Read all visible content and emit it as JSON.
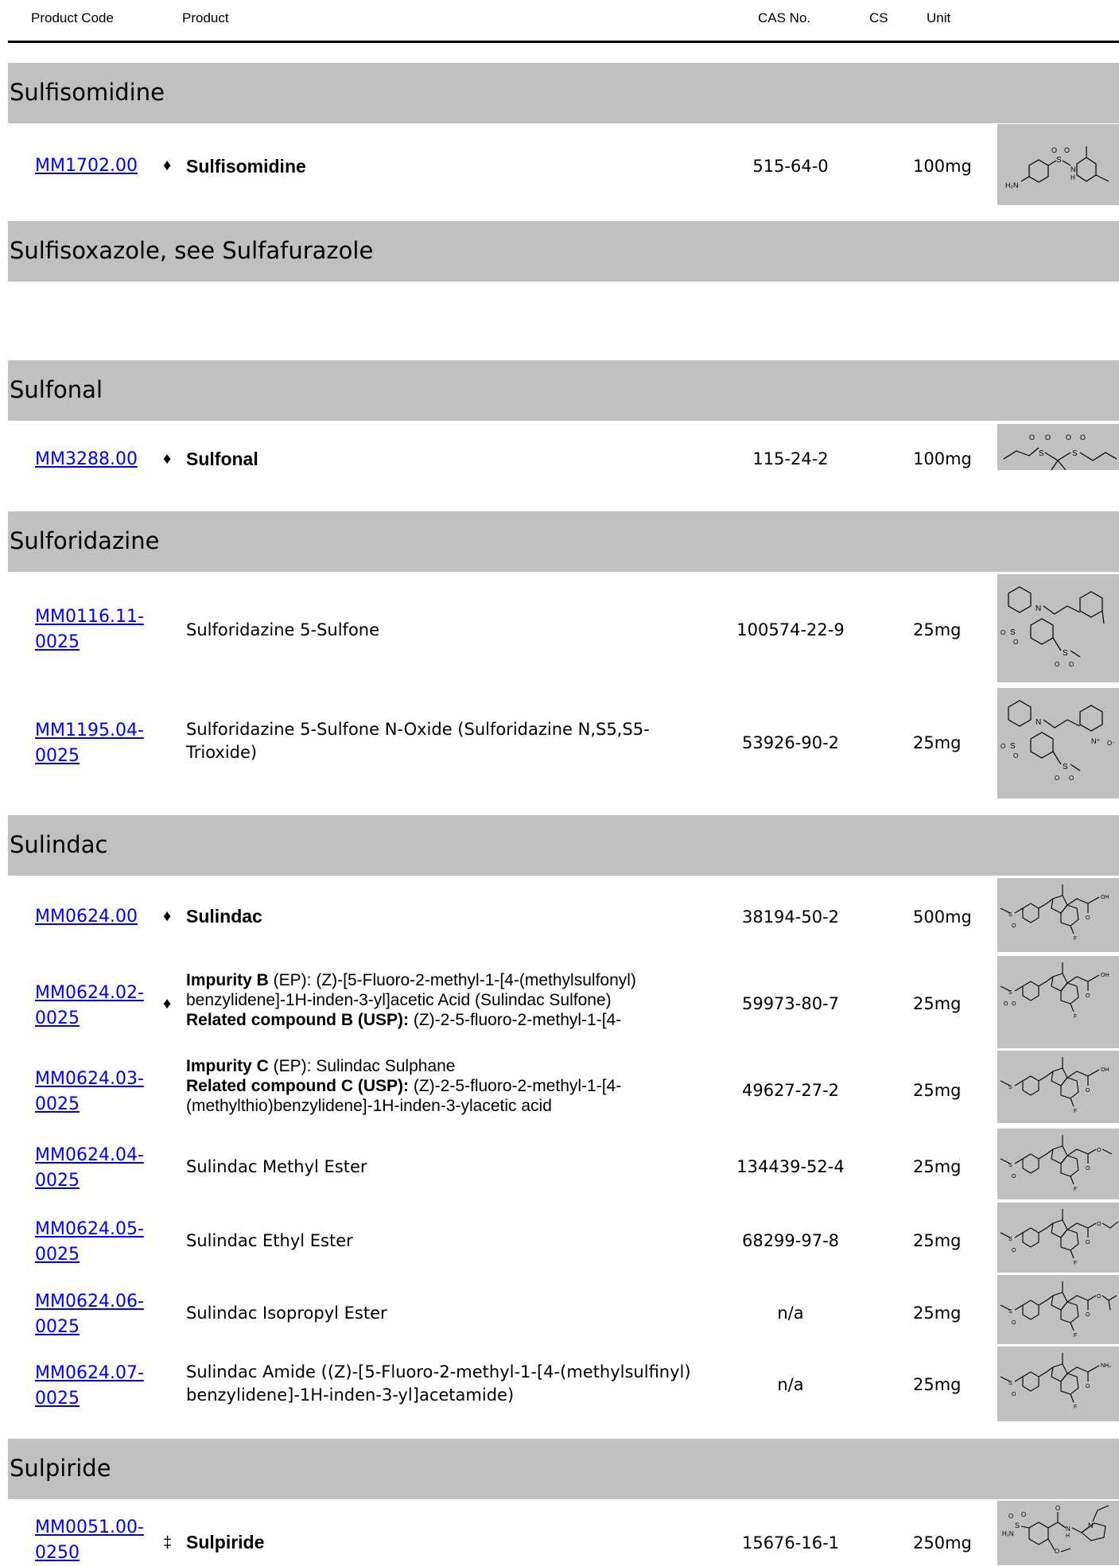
{
  "header": {
    "product_code": "Product Code",
    "product": "Product",
    "cas": "CAS No.",
    "cs": "CS",
    "unit": "Unit"
  },
  "sections": [
    {
      "title": "Sulfisomidine",
      "items": [
        {
          "code_lines": [
            "MM1702.00"
          ],
          "marker": "♦",
          "name": "Sulfisomidine",
          "bold": true,
          "cas": "515-64-0",
          "unit": "100mg",
          "structure_icon": "sulfisomidine-structure"
        }
      ]
    },
    {
      "title": "Sulfisoxazole, see Sulfafurazole",
      "items": []
    },
    {
      "title": "Sulfonal",
      "items": [
        {
          "code_lines": [
            "MM3288.00"
          ],
          "marker": "♦",
          "name": "Sulfonal",
          "bold": true,
          "cas": "115-24-2",
          "unit": "100mg",
          "structure_icon": "sulfonal-structure"
        }
      ]
    },
    {
      "title": "Sulforidazine",
      "items": [
        {
          "code_lines": [
            "MM0116.11-",
            "0025"
          ],
          "marker": "",
          "name": "Sulforidazine 5-Sulfone",
          "bold": false,
          "cas": "100574-22-9",
          "unit": "25mg",
          "structure_icon": "sulforidazine-sulfone-structure"
        },
        {
          "code_lines": [
            "MM1195.04-",
            "0025"
          ],
          "marker": "",
          "name_lines": [
            "Sulforidazine 5-Sulfone N-Oxide (Sulforidazine N,S5,S5-",
            "Trioxide)"
          ],
          "bold": false,
          "cas": "53926-90-2",
          "unit": "25mg",
          "structure_icon": "sulforidazine-trioxide-structure"
        }
      ]
    },
    {
      "title": "Sulindac",
      "items": [
        {
          "code_lines": [
            "MM0624.00"
          ],
          "marker": "♦",
          "name": "Sulindac",
          "bold": true,
          "cas": "38194-50-2",
          "unit": "500mg",
          "structure_icon": "sulindac-structure"
        },
        {
          "code_lines": [
            "MM0624.02-",
            "0025"
          ],
          "marker": "♦",
          "rich_lines": [
            {
              "b": "Impurity B",
              "t": " (EP): (Z)-[5-Fluoro-2-methyl-1-[4-(methylsulfonyl)"
            },
            {
              "b": "",
              "t": "benzylidene]-1H-inden-3-yl]acetic Acid (Sulindac Sulfone)"
            },
            {
              "b": "Related compound B (USP):",
              "t": " (Z)-2-5-fluoro-2-methyl-1-[4-"
            }
          ],
          "cas": "59973-80-7",
          "unit": "25mg",
          "structure_icon": "sulindac-sulfone-structure"
        },
        {
          "code_lines": [
            "MM0624.03-",
            "0025"
          ],
          "marker": "",
          "rich_lines": [
            {
              "b": "Impurity C",
              "t": " (EP): Sulindac Sulphane"
            },
            {
              "b": "Related compound C (USP):",
              "t": " (Z)-2-5-fluoro-2-methyl-1-[4-"
            },
            {
              "b": "",
              "t": "(methylthio)benzylidene]-1H-inden-3-ylacetic acid"
            }
          ],
          "cas": "49627-27-2",
          "unit": "25mg",
          "structure_icon": "sulindac-sulphide-structure"
        },
        {
          "code_lines": [
            "MM0624.04-",
            "0025"
          ],
          "marker": "",
          "name": "Sulindac Methyl Ester",
          "bold": false,
          "cas": "134439-52-4",
          "unit": "25mg",
          "structure_icon": "sulindac-methyl-ester-structure"
        },
        {
          "code_lines": [
            "MM0624.05-",
            "0025"
          ],
          "marker": "",
          "name": "Sulindac Ethyl Ester",
          "bold": false,
          "cas": "68299-97-8",
          "unit": "25mg",
          "structure_icon": "sulindac-ethyl-ester-structure"
        },
        {
          "code_lines": [
            "MM0624.06-",
            "0025"
          ],
          "marker": "",
          "name": "Sulindac Isopropyl Ester",
          "bold": false,
          "cas": "n/a",
          "unit": "25mg",
          "structure_icon": "sulindac-isopropyl-ester-structure"
        },
        {
          "code_lines": [
            "MM0624.07-",
            "0025"
          ],
          "marker": "",
          "name_lines": [
            "Sulindac Amide ((Z)-[5-Fluoro-2-methyl-1-[4-(methylsulfinyl)",
            "benzylidene]-1H-inden-3-yl]acetamide)"
          ],
          "bold": false,
          "cas": "n/a",
          "unit": "25mg",
          "structure_icon": "sulindac-amide-structure"
        }
      ]
    },
    {
      "title": "Sulpiride",
      "items": [
        {
          "code_lines": [
            "MM0051.00-",
            "0250"
          ],
          "marker": "‡",
          "name": "Sulpiride",
          "bold": true,
          "cas": "15676-16-1",
          "unit": "250mg",
          "structure_icon": "sulpiride-structure"
        }
      ]
    }
  ],
  "structure_labels": {
    "h2n": "H₂N",
    "n": "N",
    "h": "H",
    "s": "S",
    "o": "O",
    "f": "F",
    "oh": "OH",
    "nh2": "NH₂",
    "nplus": "N⁺",
    "ominus": "O⁻"
  },
  "colors": {
    "band": "#c0c0c0",
    "link": "#0000ee",
    "rule": "#000000"
  }
}
